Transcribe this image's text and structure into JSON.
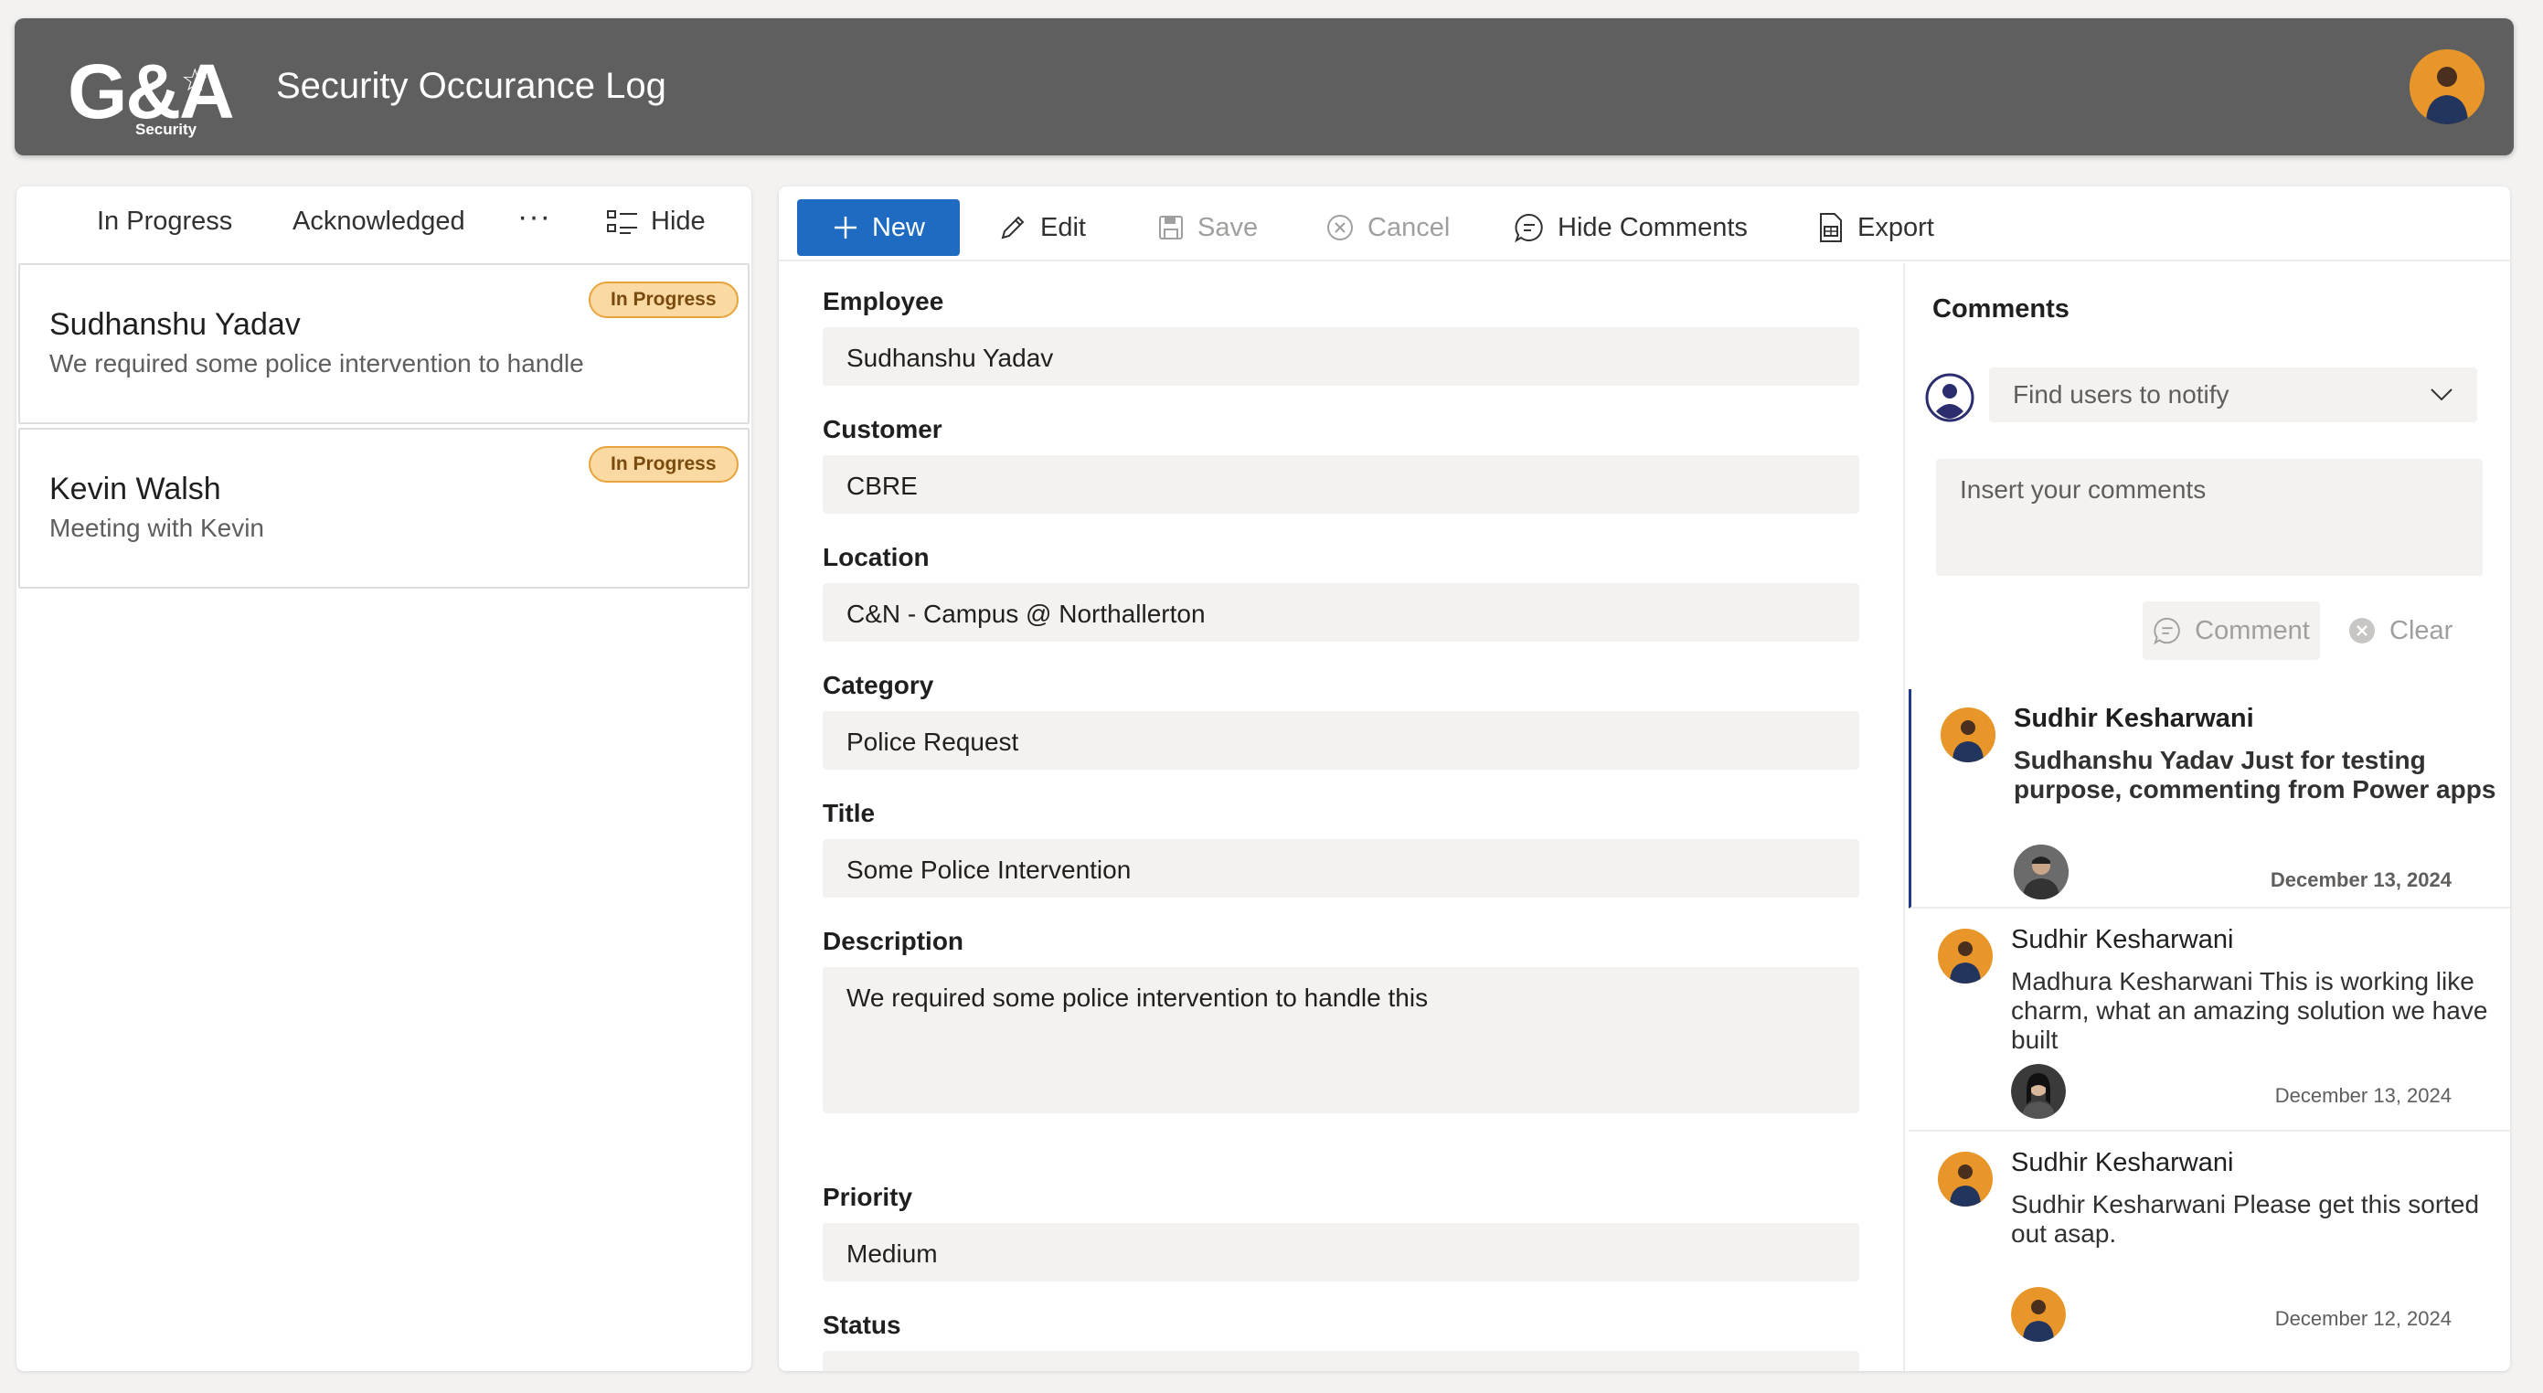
{
  "header": {
    "logo_main": "G&A",
    "logo_sub": "Security",
    "title": "Security Occurance Log"
  },
  "filters": {
    "tabs": [
      "In Progress",
      "Acknowledged"
    ],
    "more": "···",
    "hide_label": "Hide"
  },
  "cards": [
    {
      "name": "Sudhanshu Yadav",
      "description": "We required some police intervention to handle",
      "status": "In Progress"
    },
    {
      "name": "Kevin Walsh",
      "description": "Meeting with Kevin",
      "status": "In Progress"
    }
  ],
  "toolbar": {
    "new_label": "New",
    "edit_label": "Edit",
    "save_label": "Save",
    "cancel_label": "Cancel",
    "hide_comments_label": "Hide Comments",
    "export_label": "Export"
  },
  "form": {
    "employee_label": "Employee",
    "employee_value": "Sudhanshu Yadav",
    "customer_label": "Customer",
    "customer_value": "CBRE",
    "location_label": "Location",
    "location_value": "C&N - Campus @ Northallerton",
    "category_label": "Category",
    "category_value": "Police Request",
    "title_label": "Title",
    "title_value": "Some Police Intervention",
    "description_label": "Description",
    "description_value": "We required some police intervention to handle this",
    "priority_label": "Priority",
    "priority_value": "Medium",
    "status_label": "Status",
    "status_value": ""
  },
  "comments": {
    "title": "Comments",
    "notify_placeholder": "Find users to notify",
    "input_placeholder": "Insert your comments",
    "comment_button": "Comment",
    "clear_button": "Clear",
    "items": [
      {
        "author": "Sudhir Kesharwani",
        "text": "Sudhanshu Yadav Just for testing purpose,  commenting from Power apps",
        "date": "December 13, 2024"
      },
      {
        "author": "Sudhir Kesharwani",
        "text": "Madhura Kesharwani This is working like charm,  what an amazing solution we have built",
        "date": "December 13, 2024"
      },
      {
        "author": "Sudhir Kesharwani",
        "text": "Sudhir Kesharwani Please get this sorted out asap.",
        "date": "December 12, 2024"
      }
    ]
  },
  "colors": {
    "header_bg": "#5f5f5f",
    "primary": "#1f6bc1",
    "badge_bg": "#fbd9a2",
    "badge_border": "#e8a33d",
    "avatar_orange": "#e8962a"
  }
}
